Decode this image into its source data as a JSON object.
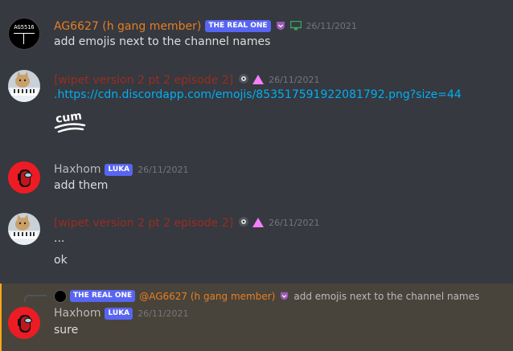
{
  "messages": [
    {
      "username": "AG6627 (h gang member)",
      "username_color": "#e67e22",
      "tag": "THE REAL ONE",
      "timestamp": "26/11/2021",
      "avatar_text": "AG5516",
      "lines": [
        "add emojis next to the channel names"
      ]
    },
    {
      "username": "[wipet version 2 pt 2 episode 2]",
      "username_color": "#992d22",
      "timestamp": "26/11/2021",
      "lines": [
        ".https://cdn.discordapp.com/emojis/853517591922081792.png?size=44"
      ],
      "emoji_text": "cum"
    },
    {
      "username": "Haxhom",
      "username_color": "#b9bbbe",
      "tag": "LUKA",
      "timestamp": "26/11/2021",
      "lines": [
        "add them"
      ]
    },
    {
      "username": "[wipet version 2 pt 2 episode 2]",
      "username_color": "#992d22",
      "timestamp": "26/11/2021",
      "lines": [
        "...",
        "ok"
      ]
    },
    {
      "reply": {
        "tag": "THE REAL ONE",
        "username": "@AG6627 (h gang member)",
        "content": "add emojis next to the channel names"
      },
      "username": "Haxhom",
      "username_color": "#b9bbbe",
      "tag": "LUKA",
      "timestamp": "26/11/2021",
      "lines": [
        "sure"
      ]
    }
  ]
}
